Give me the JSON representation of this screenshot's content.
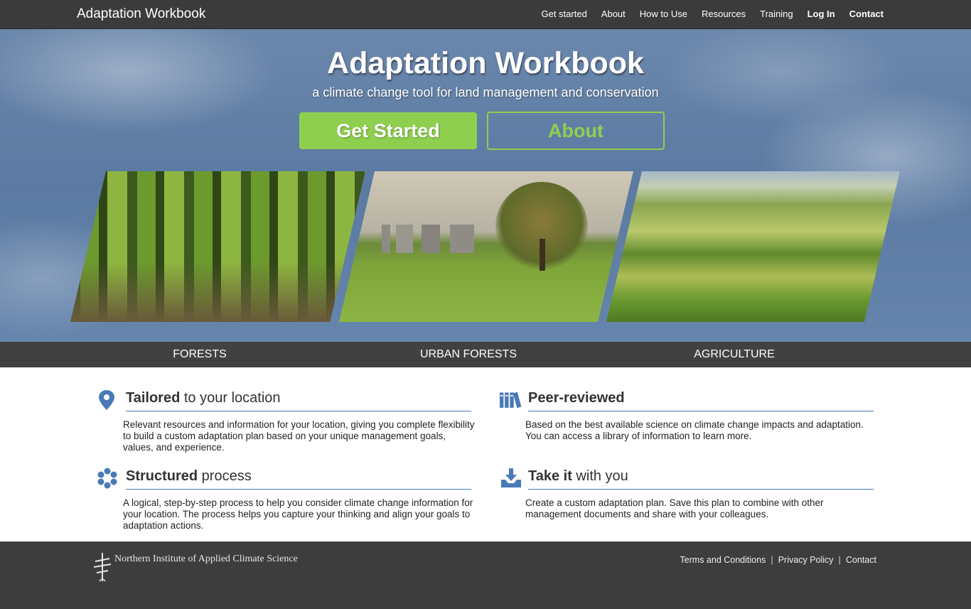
{
  "header": {
    "brand": "Adaptation Workbook",
    "nav": [
      "Get started",
      "About",
      "How to Use",
      "Resources",
      "Training",
      "Log In",
      "Contact"
    ]
  },
  "hero": {
    "title": "Adaptation Workbook",
    "subtitle": "a climate change tool for land management and conservation",
    "primary_button": "Get Started",
    "secondary_button": "About",
    "accent_color": "#8fcf4f"
  },
  "categories": [
    "FORESTS",
    "URBAN FORESTS",
    "AGRICULTURE"
  ],
  "features": [
    {
      "icon": "location-pin-icon",
      "title_bold": "Tailored",
      "title_rest": " to your location",
      "text": "Relevant resources and information for your location, giving you complete flexibility to build a custom adaptation plan based on your unique management goals, values, and experience."
    },
    {
      "icon": "books-icon",
      "title_bold": "Peer-reviewed",
      "title_rest": "",
      "text": "Based on the best available science on climate change impacts and adaptation. You can access a library of information to learn more."
    },
    {
      "icon": "cycle-dots-icon",
      "title_bold": "Structured",
      "title_rest": " process",
      "text": "A logical, step-by-step process to help you consider climate change information for your location. The process helps you capture your thinking and align your goals to adaptation actions."
    },
    {
      "icon": "download-tray-icon",
      "title_bold": "Take it",
      "title_rest": " with you",
      "text": "Create a custom adaptation plan. Save this plan to combine with other management documents and share with your colleagues."
    }
  ],
  "footer": {
    "org": "Northern Institute of Applied Climate Science",
    "links": [
      "Terms and Conditions",
      "Privacy Policy",
      "Contact"
    ]
  }
}
